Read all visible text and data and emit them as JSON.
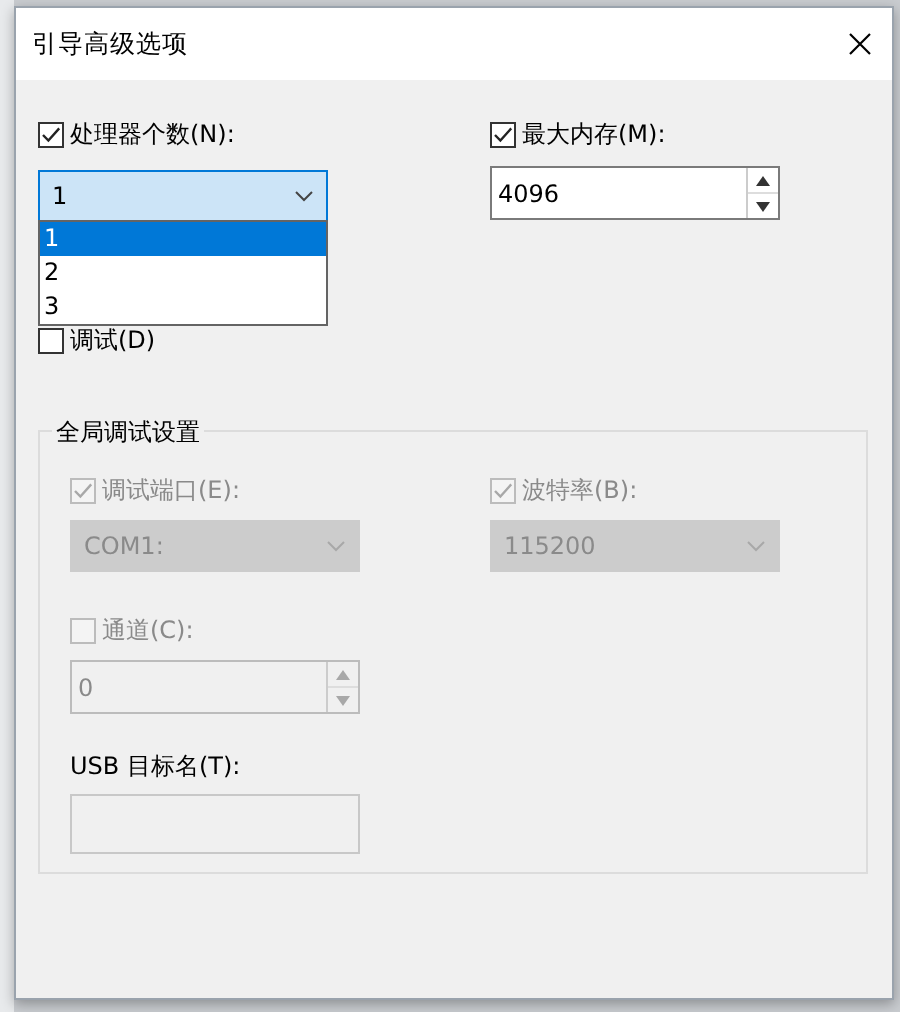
{
  "window": {
    "title": "引导高级选项"
  },
  "processors": {
    "label": "处理器个数(N):",
    "checked": true,
    "value": "1",
    "expanded": true,
    "options": [
      {
        "label": "1",
        "selected": true
      },
      {
        "label": "2",
        "selected": false
      },
      {
        "label": "3",
        "selected": false
      }
    ]
  },
  "max_memory": {
    "label": "最大内存(M):",
    "checked": true,
    "value": "4096"
  },
  "debug": {
    "label": "调试(D)",
    "checked": false
  },
  "global_debug": {
    "title": "全局调试设置",
    "debug_port": {
      "label": "调试端口(E):",
      "checked": true,
      "disabled": true,
      "value": "COM1:"
    },
    "baud_rate": {
      "label": "波特率(B):",
      "checked": true,
      "disabled": true,
      "value": "115200"
    },
    "channel": {
      "label": "通道(C):",
      "checked": false,
      "disabled": true,
      "value": "0"
    },
    "usb_target": {
      "label": "USB 目标名(T):",
      "disabled": true
    }
  }
}
